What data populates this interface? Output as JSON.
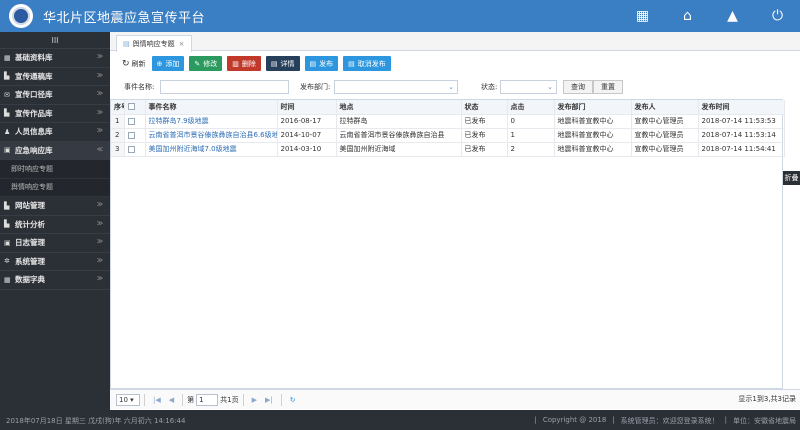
{
  "app": {
    "title": "华北片区地震应急宣传平台"
  },
  "header_icons": [
    "grid-icon",
    "home-icon",
    "lock-icon",
    "power-icon"
  ],
  "sidebar": {
    "toggle": "III",
    "items": [
      {
        "label": "基础资料库",
        "icon": "grid-icon",
        "glyph": "▦",
        "chevron": "≫"
      },
      {
        "label": "宣传通稿库",
        "icon": "document-icon",
        "glyph": "▙",
        "chevron": "≫"
      },
      {
        "label": "宣传口径库",
        "icon": "envelope-icon",
        "glyph": "✉",
        "chevron": "≫"
      },
      {
        "label": "宣传作品库",
        "icon": "document-icon",
        "glyph": "▙",
        "chevron": "≫"
      },
      {
        "label": "人员信息库",
        "icon": "user-icon",
        "glyph": "♟",
        "chevron": "≫"
      },
      {
        "label": "应急响应库",
        "icon": "list-icon",
        "glyph": "▣",
        "chevron": "≪"
      }
    ],
    "subitems": [
      {
        "label": "即时响应专题"
      },
      {
        "label": "舆情响应专题"
      }
    ],
    "items_after": [
      {
        "label": "网站管理",
        "icon": "document-icon",
        "glyph": "▙",
        "chevron": "≫"
      },
      {
        "label": "统计分析",
        "icon": "chart-icon",
        "glyph": "▙",
        "chevron": "≫"
      },
      {
        "label": "日志管理",
        "icon": "log-icon",
        "glyph": "▣",
        "chevron": "≫"
      },
      {
        "label": "系统管理",
        "icon": "gear-icon",
        "glyph": "✲",
        "chevron": "≫"
      },
      {
        "label": "数据字典",
        "icon": "grid-icon",
        "glyph": "▦",
        "chevron": "≫"
      }
    ]
  },
  "tab": {
    "label": "舆情响应专题",
    "close": "×"
  },
  "toolbar": {
    "refresh": "刷新",
    "add": "添加",
    "edit": "修改",
    "delete": "删除",
    "detail": "详情",
    "publish": "发布",
    "unpublish": "取消发布"
  },
  "search": {
    "event_name_label": "事件名称:",
    "event_name_value": "",
    "dept_label": "发布部门:",
    "dept_value": "",
    "status_label": "状态:",
    "status_value": "",
    "query": "查询",
    "reset": "重置"
  },
  "table": {
    "columns": [
      "序号",
      "",
      "事件名称",
      "时间",
      "地点",
      "状态",
      "点击",
      "发布部门",
      "发布人",
      "发布时间"
    ],
    "rows": [
      [
        "1",
        "",
        "拉特群岛7.9级地震",
        "2016-08-17",
        "拉特群岛",
        "已发布",
        "0",
        "地震科普宣教中心",
        "宣教中心管理员",
        "2018-07-14 11:53:53"
      ],
      [
        "2",
        "",
        "云南省普洱市景谷傣族彝族自治县6.6级地震",
        "2014-10-07",
        "云南省普洱市景谷傣族彝族自治县",
        "已发布",
        "1",
        "地震科普宣教中心",
        "宣教中心管理员",
        "2018-07-14 11:53:14"
      ],
      [
        "3",
        "",
        "美国加州附近海域7.0级地震",
        "2014-03-10",
        "美国加州附近海域",
        "已发布",
        "2",
        "地震科普宣教中心",
        "宣教中心管理员",
        "2018-07-14 11:54:41"
      ]
    ]
  },
  "pager": {
    "page_size": "10",
    "page_label": "第",
    "page_value": "1",
    "total_pages": "共1页",
    "info": "显示1到3,共3记录"
  },
  "side_tab": "折叠",
  "statusbar": {
    "left": "2018年07月18日 星期三 戊戌(狗)年 六月初六 14:16:44",
    "copyright": "Copyright @ 2018",
    "user": "系统管理员：欢迎您登录系统！",
    "unit": "单位：安徽省地震局"
  },
  "colors": {
    "header": "#3a7ec3",
    "sidebar": "#2b2f36",
    "link": "#2d6db5"
  }
}
